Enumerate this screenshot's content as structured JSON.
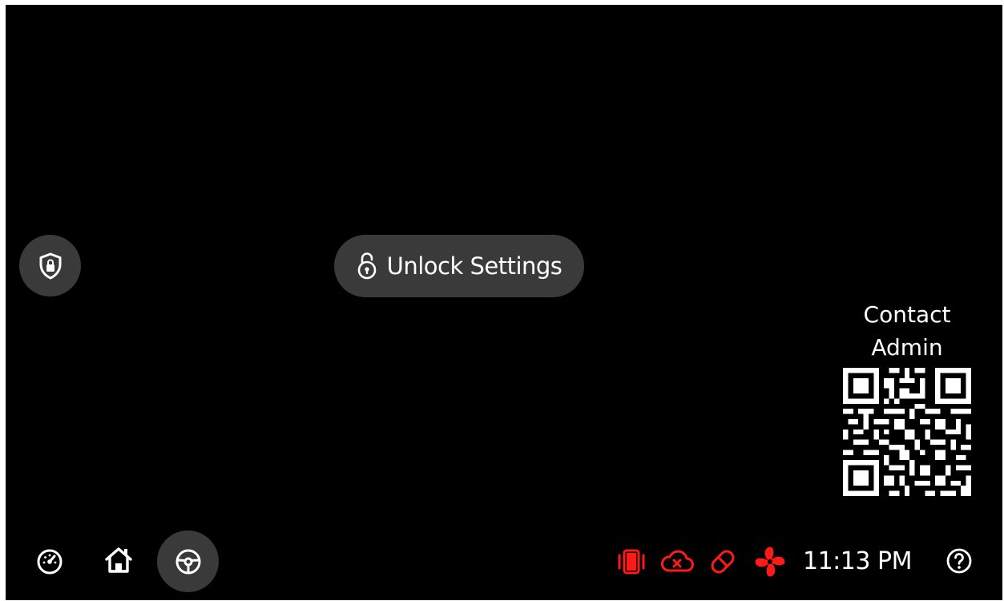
{
  "security": {
    "icon": "shield-lock-icon"
  },
  "unlock": {
    "icon": "open-padlock-icon",
    "label": "Unlock Settings"
  },
  "contact": {
    "line1": "Contact",
    "line2": "Admin",
    "qr_icon": "qr-code"
  },
  "nav": {
    "items": [
      {
        "icon": "gauge-icon",
        "active": false
      },
      {
        "icon": "home-icon",
        "active": false
      },
      {
        "icon": "steering-wheel-icon",
        "active": true
      }
    ]
  },
  "status": {
    "alert_color": "#ff1a1a",
    "icons": [
      "vibration-alert-icon",
      "cloud-disconnected-icon",
      "capsule-icon",
      "fan-icon"
    ],
    "time": "11:13 PM",
    "help_icon": "help-icon"
  },
  "colors": {
    "background": "#000000",
    "button": "#3a3a3a",
    "text": "#ffffff"
  }
}
